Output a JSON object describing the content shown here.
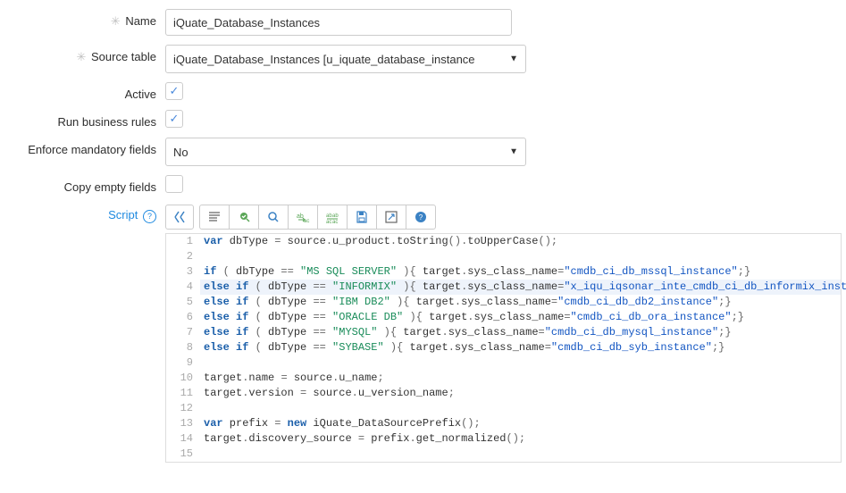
{
  "labels": {
    "name": "Name",
    "source_table": "Source table",
    "active": "Active",
    "run_rules": "Run business rules",
    "enforce": "Enforce mandatory fields",
    "copy_empty": "Copy empty fields",
    "script": "Script"
  },
  "values": {
    "name": "iQuate_Database_Instances",
    "source_table": "iQuate_Database_Instances [u_iquate_database_instance",
    "active_checked": true,
    "run_rules_checked": true,
    "enforce": "No",
    "copy_empty_checked": false
  },
  "toolbar_icons": [
    "toggle-syntax",
    "format",
    "check-syntax",
    "search",
    "replace-next",
    "replace-all",
    "save",
    "fullscreen",
    "help"
  ],
  "script_lines": [
    {
      "n": 1,
      "seg": [
        {
          "t": "kw",
          "v": "var"
        },
        {
          "t": "id",
          "v": " dbType "
        },
        {
          "t": "op",
          "v": "="
        },
        {
          "t": "id",
          "v": " source"
        },
        {
          "t": "op",
          "v": "."
        },
        {
          "t": "id",
          "v": "u_product"
        },
        {
          "t": "op",
          "v": "."
        },
        {
          "t": "id",
          "v": "toString"
        },
        {
          "t": "op",
          "v": "()."
        },
        {
          "t": "id",
          "v": "toUpperCase"
        },
        {
          "t": "op",
          "v": "();"
        }
      ]
    },
    {
      "n": 2,
      "seg": []
    },
    {
      "n": 3,
      "seg": [
        {
          "t": "kw",
          "v": "if"
        },
        {
          "t": "id",
          "v": " "
        },
        {
          "t": "op",
          "v": "("
        },
        {
          "t": "id",
          "v": " dbType "
        },
        {
          "t": "op",
          "v": "=="
        },
        {
          "t": "id",
          "v": " "
        },
        {
          "t": "str",
          "v": "\"MS SQL SERVER\""
        },
        {
          "t": "id",
          "v": " "
        },
        {
          "t": "op",
          "v": "){"
        },
        {
          "t": "id",
          "v": " target"
        },
        {
          "t": "op",
          "v": "."
        },
        {
          "t": "id",
          "v": "sys_class_name"
        },
        {
          "t": "op",
          "v": "="
        },
        {
          "t": "strblue",
          "v": "\"cmdb_ci_db_mssql_instance\""
        },
        {
          "t": "op",
          "v": ";}"
        }
      ]
    },
    {
      "n": 4,
      "hl": true,
      "seg": [
        {
          "t": "kw",
          "v": "else"
        },
        {
          "t": "id",
          "v": " "
        },
        {
          "t": "kw",
          "v": "if"
        },
        {
          "t": "id",
          "v": " "
        },
        {
          "t": "op",
          "v": "("
        },
        {
          "t": "id",
          "v": " dbType "
        },
        {
          "t": "op",
          "v": "=="
        },
        {
          "t": "id",
          "v": " "
        },
        {
          "t": "str",
          "v": "\"INFORMIX\""
        },
        {
          "t": "id",
          "v": " "
        },
        {
          "t": "op",
          "v": "){"
        },
        {
          "t": "id",
          "v": " target"
        },
        {
          "t": "op",
          "v": "."
        },
        {
          "t": "id",
          "v": "sys_class_name"
        },
        {
          "t": "op",
          "v": "="
        },
        {
          "t": "strblue",
          "v": "\"x_iqu_iqsonar_inte_cmdb_ci_db_informix_instance\""
        },
        {
          "t": "op",
          "v": ";}"
        }
      ]
    },
    {
      "n": 5,
      "seg": [
        {
          "t": "kw",
          "v": "else"
        },
        {
          "t": "id",
          "v": " "
        },
        {
          "t": "kw",
          "v": "if"
        },
        {
          "t": "id",
          "v": " "
        },
        {
          "t": "op",
          "v": "("
        },
        {
          "t": "id",
          "v": " dbType "
        },
        {
          "t": "op",
          "v": "=="
        },
        {
          "t": "id",
          "v": " "
        },
        {
          "t": "str",
          "v": "\"IBM DB2\""
        },
        {
          "t": "id",
          "v": " "
        },
        {
          "t": "op",
          "v": "){"
        },
        {
          "t": "id",
          "v": " target"
        },
        {
          "t": "op",
          "v": "."
        },
        {
          "t": "id",
          "v": "sys_class_name"
        },
        {
          "t": "op",
          "v": "="
        },
        {
          "t": "strblue",
          "v": "\"cmdb_ci_db_db2_instance\""
        },
        {
          "t": "op",
          "v": ";}"
        }
      ]
    },
    {
      "n": 6,
      "seg": [
        {
          "t": "kw",
          "v": "else"
        },
        {
          "t": "id",
          "v": " "
        },
        {
          "t": "kw",
          "v": "if"
        },
        {
          "t": "id",
          "v": " "
        },
        {
          "t": "op",
          "v": "("
        },
        {
          "t": "id",
          "v": " dbType "
        },
        {
          "t": "op",
          "v": "=="
        },
        {
          "t": "id",
          "v": " "
        },
        {
          "t": "str",
          "v": "\"ORACLE DB\""
        },
        {
          "t": "id",
          "v": " "
        },
        {
          "t": "op",
          "v": "){"
        },
        {
          "t": "id",
          "v": " target"
        },
        {
          "t": "op",
          "v": "."
        },
        {
          "t": "id",
          "v": "sys_class_name"
        },
        {
          "t": "op",
          "v": "="
        },
        {
          "t": "strblue",
          "v": "\"cmdb_ci_db_ora_instance\""
        },
        {
          "t": "op",
          "v": ";}"
        }
      ]
    },
    {
      "n": 7,
      "seg": [
        {
          "t": "kw",
          "v": "else"
        },
        {
          "t": "id",
          "v": " "
        },
        {
          "t": "kw",
          "v": "if"
        },
        {
          "t": "id",
          "v": " "
        },
        {
          "t": "op",
          "v": "("
        },
        {
          "t": "id",
          "v": " dbType "
        },
        {
          "t": "op",
          "v": "=="
        },
        {
          "t": "id",
          "v": " "
        },
        {
          "t": "str",
          "v": "\"MYSQL\""
        },
        {
          "t": "id",
          "v": " "
        },
        {
          "t": "op",
          "v": "){"
        },
        {
          "t": "id",
          "v": " target"
        },
        {
          "t": "op",
          "v": "."
        },
        {
          "t": "id",
          "v": "sys_class_name"
        },
        {
          "t": "op",
          "v": "="
        },
        {
          "t": "strblue",
          "v": "\"cmdb_ci_db_mysql_instance\""
        },
        {
          "t": "op",
          "v": ";}"
        }
      ]
    },
    {
      "n": 8,
      "seg": [
        {
          "t": "kw",
          "v": "else"
        },
        {
          "t": "id",
          "v": " "
        },
        {
          "t": "kw",
          "v": "if"
        },
        {
          "t": "id",
          "v": " "
        },
        {
          "t": "op",
          "v": "("
        },
        {
          "t": "id",
          "v": " dbType "
        },
        {
          "t": "op",
          "v": "=="
        },
        {
          "t": "id",
          "v": " "
        },
        {
          "t": "str",
          "v": "\"SYBASE\""
        },
        {
          "t": "id",
          "v": " "
        },
        {
          "t": "op",
          "v": "){"
        },
        {
          "t": "id",
          "v": " target"
        },
        {
          "t": "op",
          "v": "."
        },
        {
          "t": "id",
          "v": "sys_class_name"
        },
        {
          "t": "op",
          "v": "="
        },
        {
          "t": "strblue",
          "v": "\"cmdb_ci_db_syb_instance\""
        },
        {
          "t": "op",
          "v": ";}"
        }
      ]
    },
    {
      "n": 9,
      "seg": []
    },
    {
      "n": 10,
      "seg": [
        {
          "t": "id",
          "v": "target"
        },
        {
          "t": "op",
          "v": "."
        },
        {
          "t": "id",
          "v": "name "
        },
        {
          "t": "op",
          "v": "="
        },
        {
          "t": "id",
          "v": " source"
        },
        {
          "t": "op",
          "v": "."
        },
        {
          "t": "id",
          "v": "u_name"
        },
        {
          "t": "op",
          "v": ";"
        }
      ]
    },
    {
      "n": 11,
      "seg": [
        {
          "t": "id",
          "v": "target"
        },
        {
          "t": "op",
          "v": "."
        },
        {
          "t": "id",
          "v": "version "
        },
        {
          "t": "op",
          "v": "="
        },
        {
          "t": "id",
          "v": " source"
        },
        {
          "t": "op",
          "v": "."
        },
        {
          "t": "id",
          "v": "u_version_name"
        },
        {
          "t": "op",
          "v": ";"
        }
      ]
    },
    {
      "n": 12,
      "seg": []
    },
    {
      "n": 13,
      "seg": [
        {
          "t": "kw",
          "v": "var"
        },
        {
          "t": "id",
          "v": " prefix "
        },
        {
          "t": "op",
          "v": "="
        },
        {
          "t": "id",
          "v": " "
        },
        {
          "t": "kw",
          "v": "new"
        },
        {
          "t": "id",
          "v": " iQuate_DataSourcePrefix"
        },
        {
          "t": "op",
          "v": "();"
        }
      ]
    },
    {
      "n": 14,
      "seg": [
        {
          "t": "id",
          "v": "target"
        },
        {
          "t": "op",
          "v": "."
        },
        {
          "t": "id",
          "v": "discovery_source "
        },
        {
          "t": "op",
          "v": "="
        },
        {
          "t": "id",
          "v": " prefix"
        },
        {
          "t": "op",
          "v": "."
        },
        {
          "t": "id",
          "v": "get_normalized"
        },
        {
          "t": "op",
          "v": "();"
        }
      ]
    },
    {
      "n": 15,
      "seg": []
    }
  ]
}
